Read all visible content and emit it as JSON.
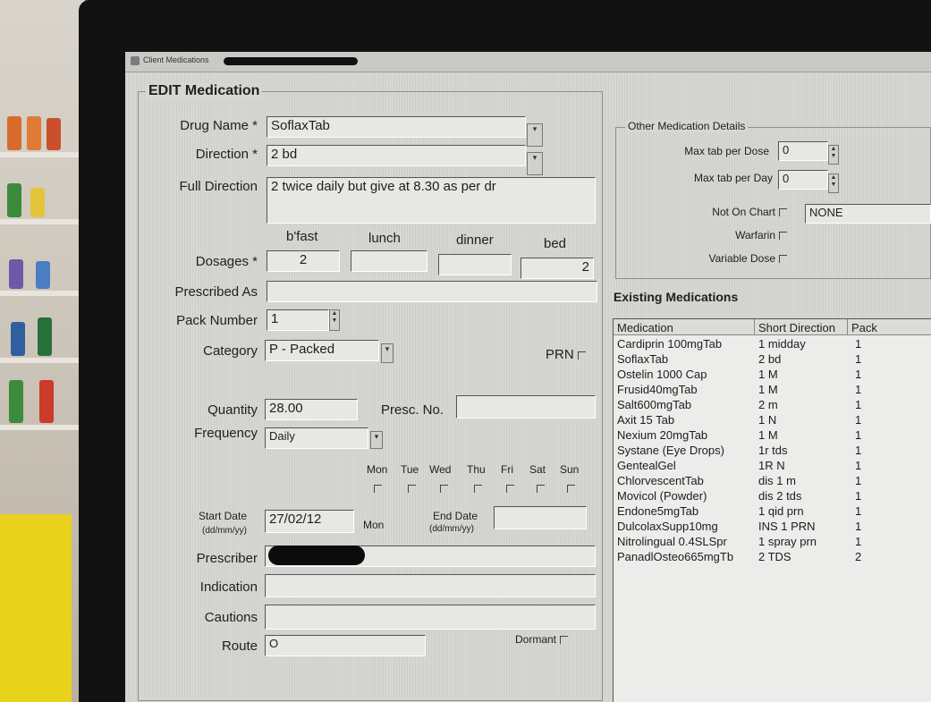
{
  "window": {
    "title": "Client Medications"
  },
  "edit": {
    "group_title": "EDIT Medication",
    "drug_name_label": "Drug Name *",
    "drug_name_value": "SoflaxTab",
    "direction_label": "Direction *",
    "direction_value": "2 bd",
    "full_direction_label": "Full Direction",
    "full_direction_value": "2 twice daily  but give at  8.30 as per dr",
    "dose_headers": [
      "b'fast",
      "lunch",
      "dinner",
      "bed"
    ],
    "dosages_label": "Dosages *",
    "dosages": [
      "2",
      "",
      "",
      "2"
    ],
    "prescribed_as_label": "Prescribed As",
    "prescribed_as_value": "",
    "pack_number_label": "Pack Number",
    "pack_number_value": "1",
    "category_label": "Category",
    "category_value": "P - Packed",
    "prn_label": "PRN",
    "quantity_label": "Quantity",
    "quantity_value": "28.00",
    "presc_no_label": "Presc. No.",
    "presc_no_value": "",
    "frequency_label": "Frequency",
    "frequency_value": "Daily",
    "days": [
      "Mon",
      "Tue",
      "Wed",
      "Thu",
      "Fri",
      "Sat",
      "Sun"
    ],
    "start_date_label": "Start Date",
    "start_date_format": "(dd/mm/yy)",
    "start_date_value": "27/02/12",
    "start_day": "Mon",
    "end_date_label": "End Date",
    "end_date_format": "(dd/mm/yy)",
    "end_date_value": "",
    "prescriber_label": "Prescriber",
    "indication_label": "Indication",
    "indication_value": "",
    "cautions_label": "Cautions",
    "cautions_value": "",
    "route_label": "Route",
    "route_value": "O",
    "dormant_label": "Dormant"
  },
  "other": {
    "group_title": "Other Medication Details",
    "max_tab_dose_label": "Max tab per Dose",
    "max_tab_dose_value": "0",
    "max_tab_day_label": "Max tab per Day",
    "max_tab_day_value": "0",
    "not_on_chart_label": "Not On Chart",
    "not_on_chart_value": "NONE",
    "warfarin_label": "Warfarin",
    "variable_dose_label": "Variable Dose"
  },
  "existing": {
    "title": "Existing Medications",
    "columns": [
      "Medication",
      "Short Direction",
      "Pack"
    ],
    "rows": [
      [
        "Cardiprin 100mgTab",
        "1 midday",
        "1"
      ],
      [
        "SoflaxTab",
        "2 bd",
        "1"
      ],
      [
        "Ostelin 1000 Cap",
        "1 M",
        "1"
      ],
      [
        "Frusid40mgTab",
        "1 M",
        "1"
      ],
      [
        "Salt600mgTab",
        "2 m",
        "1"
      ],
      [
        "Axit 15 Tab",
        "1 N",
        "1"
      ],
      [
        "Nexium 20mgTab",
        "1 M",
        "1"
      ],
      [
        "Systane (Eye Drops)",
        "1r tds",
        "1"
      ],
      [
        "GentealGel",
        "1R N",
        "1"
      ],
      [
        "ChlorvescentTab",
        "dis 1 m",
        "1"
      ],
      [
        "Movicol (Powder)",
        "dis 2 tds",
        "1"
      ],
      [
        "Endone5mgTab",
        "1 qid prn",
        "1"
      ],
      [
        "DulcolaxSupp10mg",
        "INS 1 PRN",
        "1"
      ],
      [
        "Nitrolingual 0.4SLSpr",
        "1 spray prn",
        "1"
      ],
      [
        "PanadlOsteo665mgTb",
        "2 TDS",
        "2"
      ]
    ]
  }
}
